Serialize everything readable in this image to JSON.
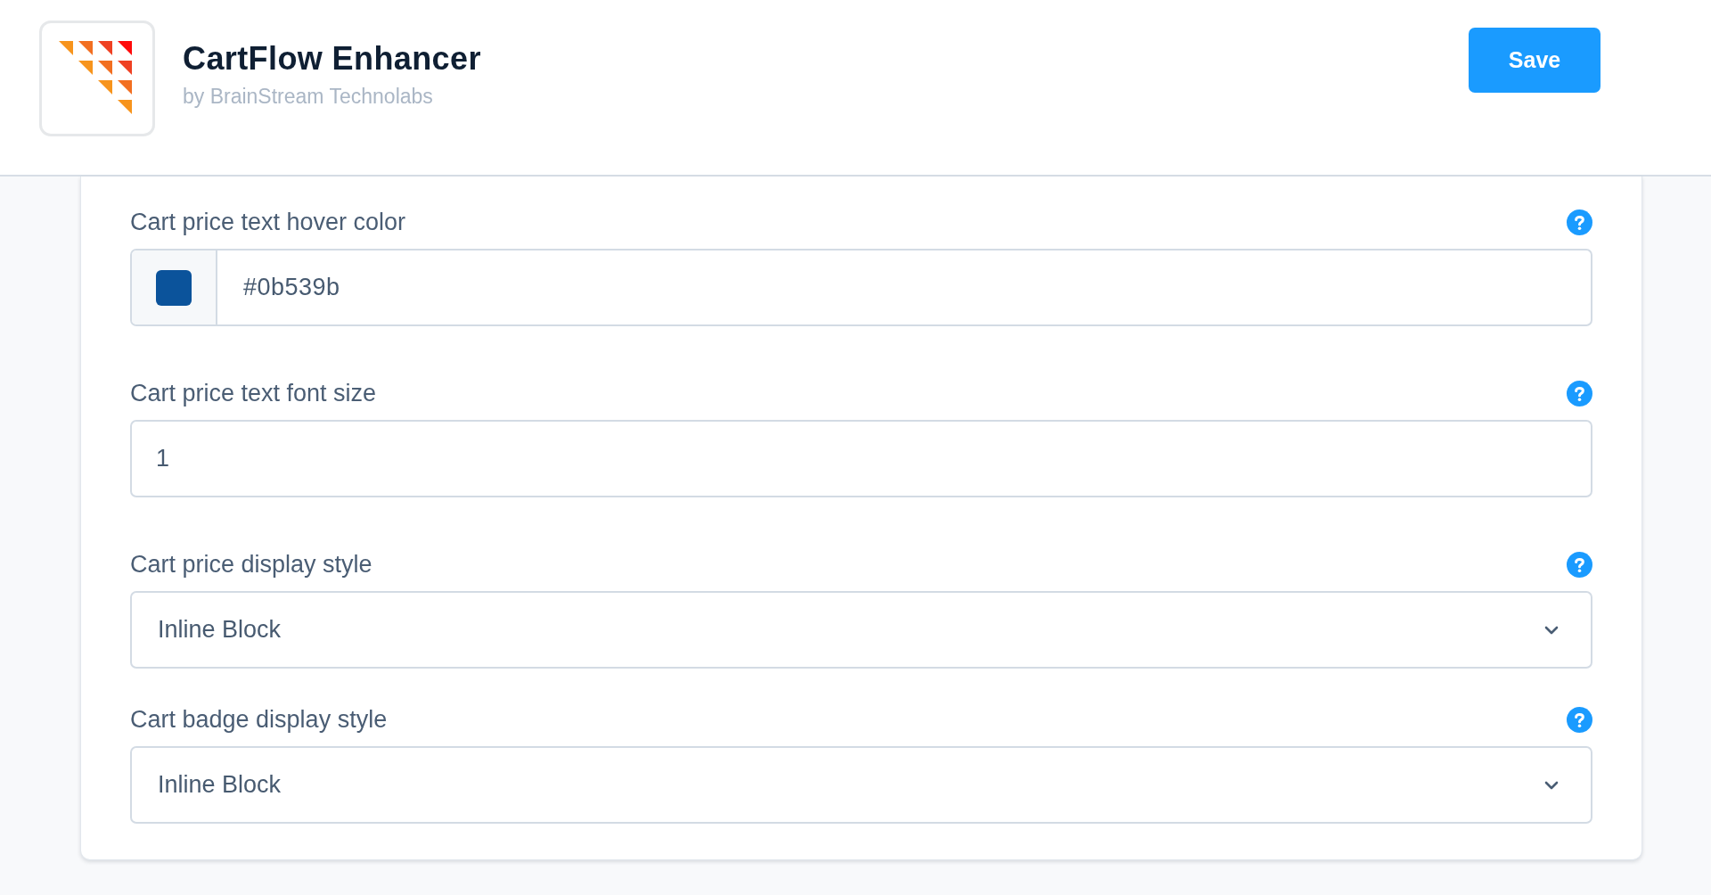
{
  "header": {
    "app_name": "CartFlow Enhancer",
    "developer": "by BrainStream Technolabs",
    "save_button": "Save"
  },
  "settings": [
    {
      "kind": "color",
      "label": "Cart price text hover color",
      "value": "#0b539b",
      "color": "#0b539b"
    },
    {
      "kind": "text",
      "label": "Cart price text font size",
      "value": "1"
    },
    {
      "kind": "select",
      "label": "Cart price display style",
      "value": "Inline Block"
    },
    {
      "kind": "select",
      "label": "Cart badge display style",
      "value": "Inline Block"
    }
  ]
}
